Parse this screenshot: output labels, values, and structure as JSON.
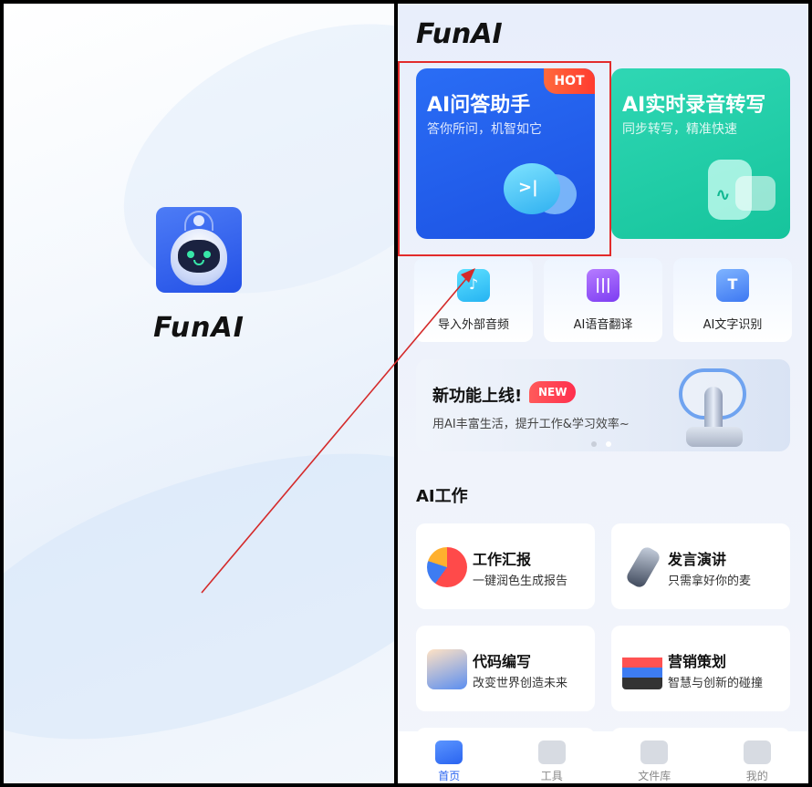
{
  "splash": {
    "app_name": "FunAI"
  },
  "home": {
    "brand": "FunAI",
    "feature_cards": [
      {
        "title": "AI问答助手",
        "subtitle": "答你所问，机智如它",
        "badge": "HOT",
        "color": "#2a6df5"
      },
      {
        "title": "AI实时录音转写",
        "subtitle": "同步转写，精准快速",
        "color": "#2fd7b4"
      }
    ],
    "quick_tools": [
      {
        "label": "导入外部音频"
      },
      {
        "label": "AI语音翻译"
      },
      {
        "label": "AI文字识别"
      }
    ],
    "banner": {
      "title": "新功能上线!",
      "badge": "NEW",
      "subtitle": "用AI丰富生活，提升工作&学习效率~"
    },
    "section_title": "AI工作",
    "work_items": [
      {
        "title": "工作汇报",
        "subtitle": "一键润色生成报告"
      },
      {
        "title": "发言演讲",
        "subtitle": "只需拿好你的麦"
      },
      {
        "title": "代码编写",
        "subtitle": "改变世界创造未来"
      },
      {
        "title": "营销策划",
        "subtitle": "智慧与创新的碰撞"
      }
    ],
    "tabs": [
      {
        "label": "首页",
        "active": true
      },
      {
        "label": "工具"
      },
      {
        "label": "文件库"
      },
      {
        "label": "我的"
      }
    ]
  },
  "annotation": {
    "highlight_color": "#e22b2b"
  }
}
